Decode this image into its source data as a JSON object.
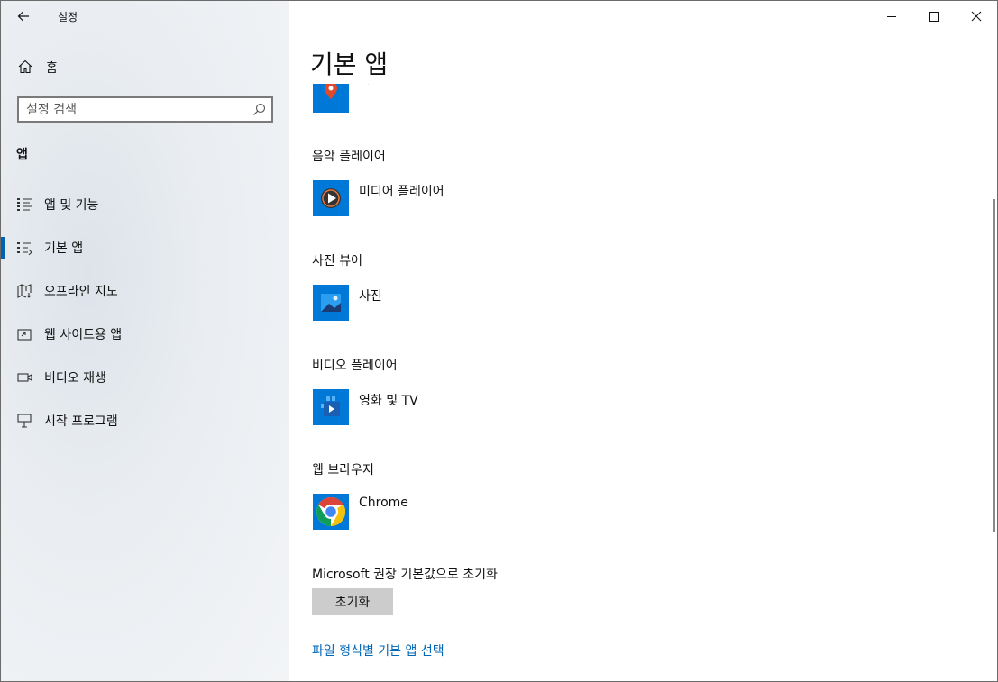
{
  "window": {
    "title": "설정"
  },
  "sidebar": {
    "home_label": "홈",
    "search_placeholder": "설정 검색",
    "section": "앱",
    "items": [
      {
        "label": "앱 및 기능",
        "icon": "apps-features-icon"
      },
      {
        "label": "기본 앱",
        "icon": "default-apps-icon",
        "selected": true
      },
      {
        "label": "오프라인 지도",
        "icon": "offline-maps-icon"
      },
      {
        "label": "웹 사이트용 앱",
        "icon": "apps-for-websites-icon"
      },
      {
        "label": "비디오 재생",
        "icon": "video-playback-icon"
      },
      {
        "label": "시작 프로그램",
        "icon": "startup-icon"
      }
    ]
  },
  "main": {
    "title": "기본 앱",
    "partial_app_label": "지도",
    "categories": [
      {
        "label": "음악 플레이어",
        "app": "미디어 플레이어",
        "icon": "media-player-icon"
      },
      {
        "label": "사진 뷰어",
        "app": "사진",
        "icon": "photos-icon"
      },
      {
        "label": "비디오 플레이어",
        "app": "영화 및 TV",
        "icon": "movies-tv-icon"
      },
      {
        "label": "웹 브라우저",
        "app": "Chrome",
        "icon": "chrome-icon"
      }
    ],
    "reset_label": "Microsoft 권장 기본값으로 초기화",
    "reset_button": "초기화",
    "file_type_link": "파일 형식별 기본 앱 선택"
  },
  "colors": {
    "accent": "#0063b1",
    "tile": "#0078d7",
    "link": "#0067b8"
  }
}
